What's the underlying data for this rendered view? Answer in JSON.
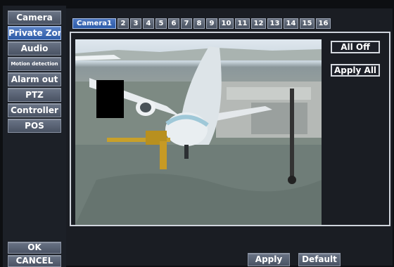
{
  "sidebar": {
    "items": [
      {
        "label": "Camera"
      },
      {
        "label": "Private Zone"
      },
      {
        "label": "Audio"
      },
      {
        "label": "Motion detection"
      },
      {
        "label": "Alarm out"
      },
      {
        "label": "PTZ"
      },
      {
        "label": "Controller"
      },
      {
        "label": "POS"
      }
    ],
    "ok_label": "OK",
    "cancel_label": "CANCEL"
  },
  "tabs": [
    "Camera1",
    "2",
    "3",
    "4",
    "5",
    "6",
    "7",
    "8",
    "9",
    "10",
    "11",
    "12",
    "13",
    "14",
    "15",
    "16"
  ],
  "actions": {
    "all_off": "All Off",
    "apply_all": "Apply All",
    "apply": "Apply",
    "default": "Default"
  },
  "colors": {
    "active_tab": "#2e5ca8",
    "button": "#4a5364",
    "mask": "#000000"
  }
}
